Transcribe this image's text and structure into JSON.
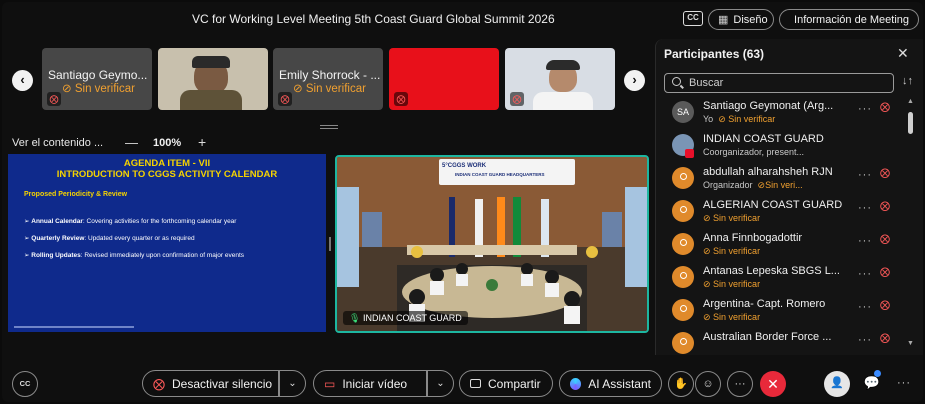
{
  "window": {
    "title": "VC for Working Level Meeting 5th Coast Guard Global Summit 2026",
    "cc_label": "CC",
    "layout_label": "Diseño",
    "info_label": "Información de Meeting"
  },
  "thumbnails": [
    {
      "name": "Santiago Geymo...",
      "status": "Sin verificar"
    },
    {
      "name": "",
      "status": ""
    },
    {
      "name": "Emily Shorrock - ...",
      "status": "Sin verificar"
    },
    {
      "name": "",
      "status": ""
    },
    {
      "name": "",
      "status": ""
    }
  ],
  "view": {
    "content_label": "Ver el contenido ...",
    "zoom": "100%"
  },
  "slide": {
    "title_line1": "AGENDA ITEM - VII",
    "title_line2": "INTRODUCTION TO CGGS ACTIVITY CALENDAR",
    "subtitle": "Proposed Periodicity & Review",
    "bullets": [
      {
        "term": "Annual Calendar",
        "text": ": Covering activities for the forthcoming calendar year"
      },
      {
        "term": "Quarterly Review",
        "text": ": Updated every quarter or as required"
      },
      {
        "term": "Rolling Updates",
        "text": ": Revised immediately upon confirmation of major events"
      }
    ]
  },
  "video": {
    "banner_line1": "5°CGGS WORK",
    "banner_line2": "INDIAN COAST GUARD HEADQUARTERS",
    "label": "INDIAN COAST GUARD"
  },
  "participants": {
    "title": "Participantes (63)",
    "search_placeholder": "Buscar",
    "items": [
      {
        "avatar": "SA",
        "name": "Santiago Geymonat (Arg...",
        "sub1": "Yo",
        "sub2": "Sin verificar",
        "muted": true
      },
      {
        "avatar": "",
        "name": "INDIAN COAST GUARD",
        "sub1": "Coorganizador, present...",
        "sub2": "",
        "muted": false
      },
      {
        "avatar": "",
        "name": "abdullah alharahsheh RJN",
        "sub1": "Organizador",
        "sub2": "Sin veri...",
        "muted": true
      },
      {
        "avatar": "",
        "name": "ALGERIAN COAST GUARD",
        "sub1": "",
        "sub2": "Sin verificar",
        "muted": true
      },
      {
        "avatar": "",
        "name": "Anna Finnbogadottir",
        "sub1": "",
        "sub2": "Sin verificar",
        "muted": true
      },
      {
        "avatar": "",
        "name": "Antanas Lepeska SBGS L...",
        "sub1": "",
        "sub2": "Sin verificar",
        "muted": true
      },
      {
        "avatar": "",
        "name": "Argentina- Capt. Romero",
        "sub1": "",
        "sub2": "Sin verificar",
        "muted": true
      },
      {
        "avatar": "",
        "name": "Australian Border Force ...",
        "sub1": "",
        "sub2": "",
        "muted": true
      }
    ]
  },
  "toolbar": {
    "cc_label": "CC",
    "mute_label": "Desactivar silencio",
    "video_label": "Iniciar vídeo",
    "share_label": "Compartir",
    "ai_label": "AI Assistant"
  },
  "colors": {
    "accent_warning": "#f0a030",
    "muted_red": "#ff5a5a",
    "end_call": "#e8293a",
    "active_speaker": "#1db6a0",
    "slide_bg": "#0f2a8c",
    "slide_title": "#f5d300"
  }
}
